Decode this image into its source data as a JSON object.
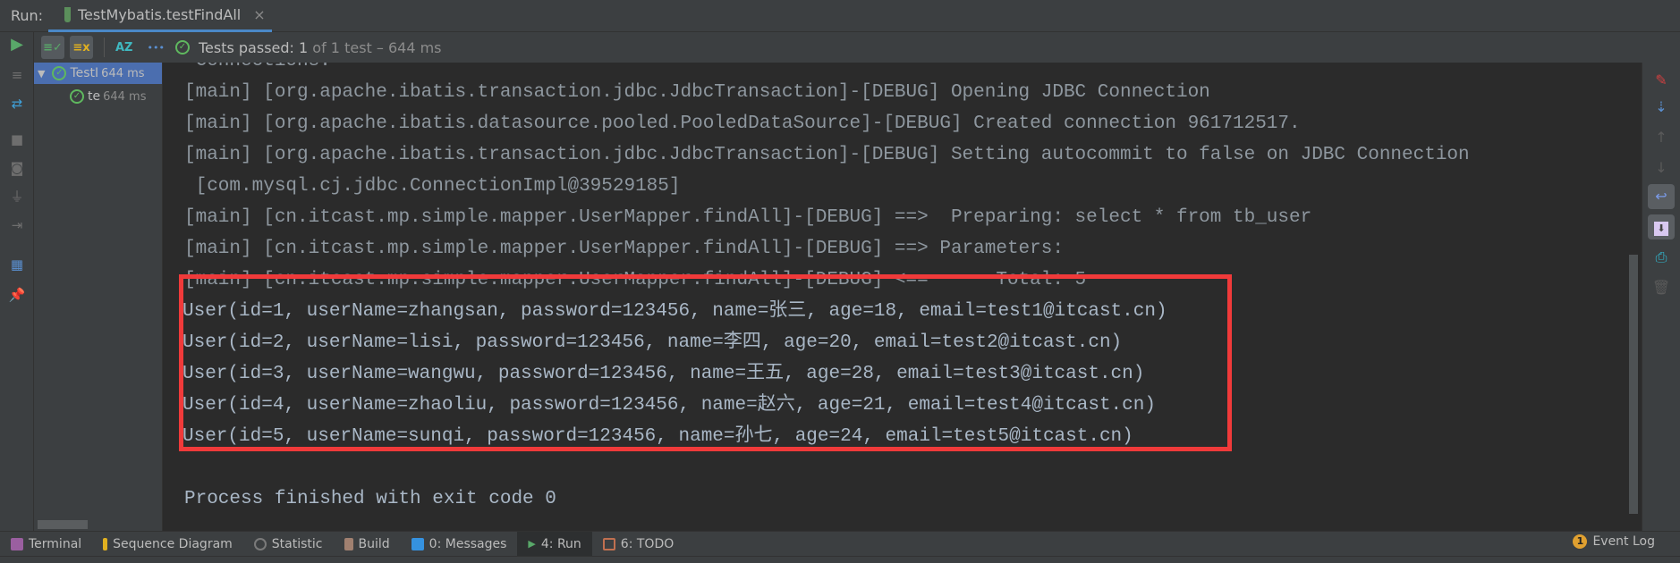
{
  "run_panel": {
    "label": "Run:",
    "tab_title": "TestMybatis.testFindAll",
    "tab_close": "×"
  },
  "toolbar": {
    "status_prefix": "Tests passed:",
    "status_count": "1",
    "status_suffix": "of 1 test – 644 ms",
    "sort_label": "AZ",
    "more": "•••"
  },
  "tree": [
    {
      "label": "TestI",
      "time": "644 ms",
      "expanded": true
    },
    {
      "label": "te",
      "time": "644 ms"
    }
  ],
  "console": {
    "lines": [
      " Connections.",
      "[main] [org.apache.ibatis.transaction.jdbc.JdbcTransaction]-[DEBUG] Opening JDBC Connection",
      "[main] [org.apache.ibatis.datasource.pooled.PooledDataSource]-[DEBUG] Created connection 961712517.",
      "[main] [org.apache.ibatis.transaction.jdbc.JdbcTransaction]-[DEBUG] Setting autocommit to false on JDBC Connection",
      " [com.mysql.cj.jdbc.ConnectionImpl@39529185]",
      "[main] [cn.itcast.mp.simple.mapper.UserMapper.findAll]-[DEBUG] ==>  Preparing: select * from tb_user",
      "[main] [cn.itcast.mp.simple.mapper.UserMapper.findAll]-[DEBUG] ==> Parameters: ",
      "[main] [cn.itcast.mp.simple.mapper.UserMapper.findAll]-[DEBUG] <==      Total: 5"
    ],
    "results": [
      "User(id=1, userName=zhangsan, password=123456, name=张三, age=18, email=test1@itcast.cn)",
      "User(id=2, userName=lisi, password=123456, name=李四, age=20, email=test2@itcast.cn)",
      "User(id=3, userName=wangwu, password=123456, name=王五, age=28, email=test3@itcast.cn)",
      "User(id=4, userName=zhaoliu, password=123456, name=赵六, age=21, email=test4@itcast.cn)",
      "User(id=5, userName=sunqi, password=123456, name=孙七, age=24, email=test5@itcast.cn)"
    ],
    "exit": "Process finished with exit code 0",
    "highlight_color": "#f03a3a"
  },
  "bottom_tabs": [
    {
      "label": "Terminal",
      "icon": "terminal-icon",
      "color": "#9a5fa0"
    },
    {
      "label": "Sequence Diagram",
      "icon": "sequence-diagram-icon",
      "color": "#e0b020"
    },
    {
      "label": "Statistic",
      "icon": "statistic-icon",
      "color": "#7a7a7a"
    },
    {
      "label": "Build",
      "icon": "build-icon",
      "color": "#a08070"
    },
    {
      "label": "0: Messages",
      "icon": "messages-icon",
      "color": "#3592e0"
    },
    {
      "label": "4: Run",
      "icon": "run-icon",
      "color": "#59a869",
      "active": true
    },
    {
      "label": "6: TODO",
      "icon": "todo-icon",
      "color": "#c07050"
    }
  ],
  "event_log": {
    "count": "1",
    "label": "Event Log"
  }
}
